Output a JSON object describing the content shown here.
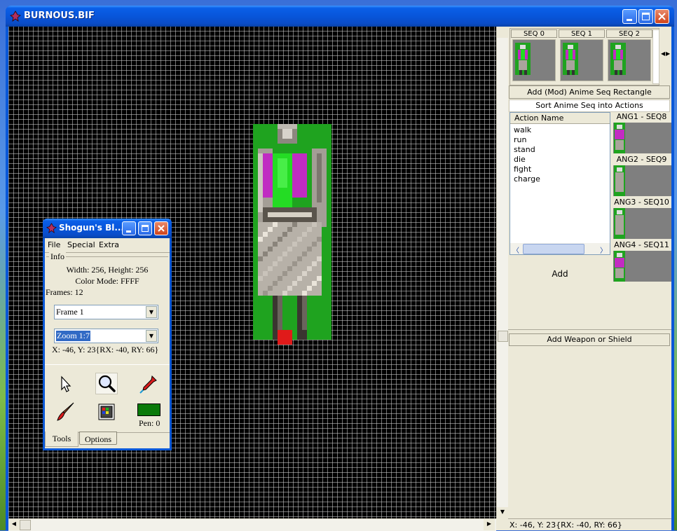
{
  "window": {
    "title": "BURNOUS.BIF"
  },
  "sequences": [
    {
      "label": "SEQ 0"
    },
    {
      "label": "SEQ 1"
    },
    {
      "label": "SEQ 2"
    }
  ],
  "buttons": {
    "add_anime_seq": "Add (Mod) Anime Seq Rectangle",
    "sort_actions": "Sort  Anime Seq into Actions",
    "add": "Add",
    "add_weapon": "Add Weapon or Shield"
  },
  "actions": {
    "header": "Action Name",
    "items": [
      "walk",
      "run",
      "stand",
      "die",
      "fight",
      "charge"
    ]
  },
  "angles": [
    {
      "label": "ANG1 - SEQ8"
    },
    {
      "label": "ANG2 - SEQ9"
    },
    {
      "label": "ANG3 - SEQ10"
    },
    {
      "label": "ANG4 - SEQ11"
    }
  ],
  "status": {
    "coords": "X: -46, Y: 23{RX: -40, RY: 66}"
  },
  "tool_window": {
    "title": "Shogun's Bl...",
    "menu": [
      "File",
      "Special",
      "Extra"
    ],
    "info_label": "Info",
    "size_text": "Width: 256, Height: 256",
    "color_mode": "Color Mode: FFFF",
    "frames": "Frames: 12",
    "frame_select": "Frame 1",
    "zoom_select": "Zoom 1:7",
    "coords": "X: -46, Y: 23{RX: -40, RY: 66}",
    "pen": "Pen: 0",
    "pen_color": "#0a7a0a",
    "tabs": [
      "Tools",
      "Options"
    ]
  }
}
